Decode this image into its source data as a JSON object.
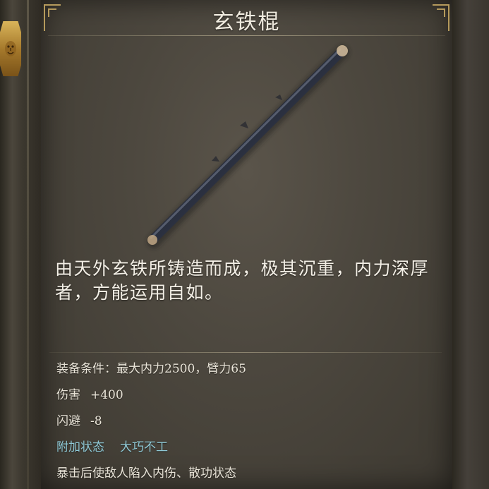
{
  "item": {
    "name": "玄铁棍",
    "description": "由天外玄铁所铸造而成，极其沉重，内力深厚者，方能运用自如。",
    "image_icon": "iron-staff-icon"
  },
  "stats": {
    "requirement": "装备条件：最大内力2500，臂力65",
    "damage_label": "伤害",
    "damage_value": "+400",
    "dodge_label": "闪避",
    "dodge_value": "-8",
    "status_label": "附加状态",
    "status_value": "大巧不工",
    "effect": "暴击后使敌人陷入内伤、散功状态"
  },
  "colors": {
    "special_status": "#8fc9d6",
    "trim_gold": "#b59a5c",
    "text": "#f1ece0"
  }
}
